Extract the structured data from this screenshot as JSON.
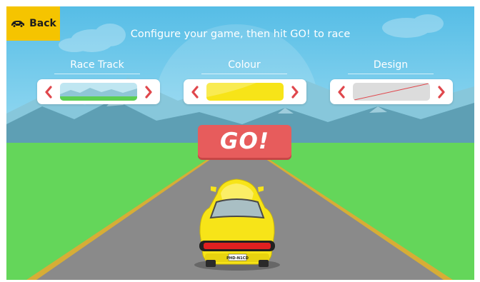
{
  "header": {
    "back_label": "Back",
    "instruction": "Configure your game, then hit GO! to race"
  },
  "options": {
    "race_track": {
      "label": "Race Track",
      "selected": "green-track-preview"
    },
    "colour": {
      "label": "Colour",
      "selected": "#f7e418"
    },
    "design": {
      "label": "Design",
      "selected": "none"
    }
  },
  "go_label": "GO!",
  "car": {
    "plate": "PHD-N1CD",
    "color": "#f7e418"
  },
  "colors": {
    "sky": "#69c6e9",
    "grass": "#64d65a",
    "road": "#8a8a8a",
    "accent": "#f5c400",
    "go_button": "#e75c5c",
    "arrow": "#e0474c"
  },
  "icons": {
    "back": "car-icon",
    "prev": "chevron-left-icon",
    "next": "chevron-right-icon"
  }
}
